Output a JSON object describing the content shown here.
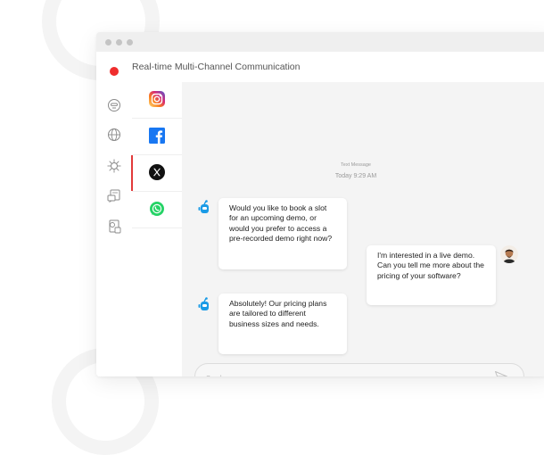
{
  "window": {
    "title": "Real-time Multi-Channel Communication"
  },
  "rail_icons": [
    "robot-face-icon",
    "globe-icon",
    "virus-icon",
    "chat-document-icon",
    "gear-document-icon"
  ],
  "channels": [
    {
      "name": "Instagram",
      "icon": "instagram-icon",
      "active": false
    },
    {
      "name": "Facebook",
      "icon": "facebook-icon",
      "active": false
    },
    {
      "name": "X",
      "icon": "x-icon",
      "active": true
    },
    {
      "name": "WhatsApp",
      "icon": "whatsapp-icon",
      "active": false
    }
  ],
  "chat": {
    "meta_label": "Text Message",
    "meta_time": "Today 9:29 AM",
    "messages": [
      {
        "sender": "bot",
        "text": "Would you like to book a slot for an upcoming demo, or would you prefer to access a pre-recorded demo right now?"
      },
      {
        "sender": "user",
        "text": "I'm interested in a live demo. Can you tell me more about the pricing of your software?"
      },
      {
        "sender": "bot",
        "text": "Absolutely! Our pricing plans are tailored to different business sizes and needs."
      }
    ]
  },
  "composer": {
    "placeholder": "Send messages"
  },
  "colors": {
    "accent": "#e23a3a",
    "record_dot": "#ef2d2d",
    "bot_icon": "#1a9be6",
    "chat_bg": "#f4f4f4"
  }
}
